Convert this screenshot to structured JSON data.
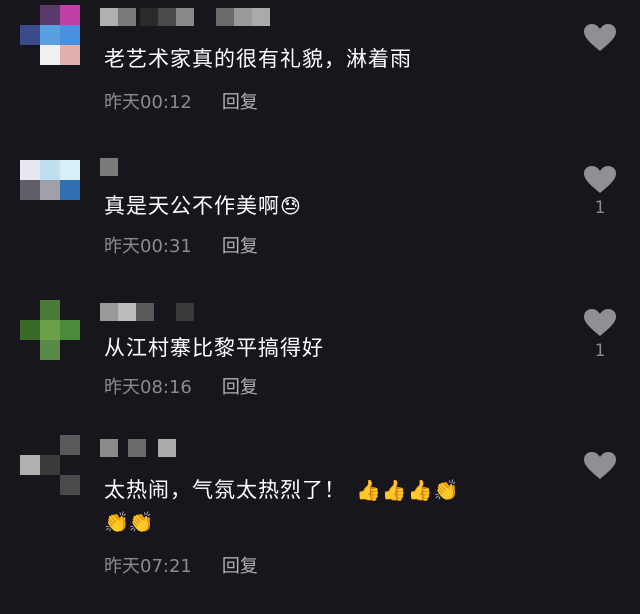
{
  "comments": [
    {
      "text": "老艺术家真的很有礼貌，淋着雨",
      "time": "昨天00:12",
      "reply": "回复",
      "likes": "",
      "emoji_line1": "",
      "emoji_line2": ""
    },
    {
      "text": "真是天公不作美啊",
      "time": "昨天00:31",
      "reply": "回复",
      "likes": "1",
      "emoji_line1": "😓",
      "emoji_line2": ""
    },
    {
      "text": "从江村寨比黎平搞得好",
      "time": "昨天08:16",
      "reply": "回复",
      "likes": "1",
      "emoji_line1": "",
      "emoji_line2": ""
    },
    {
      "text": "太热闹，气氛太热烈了！",
      "time": "昨天07:21",
      "reply": "回复",
      "likes": "",
      "emoji_line1": "👍👍👍👏",
      "emoji_line2": "👏👏"
    }
  ],
  "icons": {
    "like": "heart-icon"
  },
  "colors": {
    "background": "#16161c",
    "text": "#ffffff",
    "meta": "#8a8a90",
    "heart": "#8f8f96"
  }
}
